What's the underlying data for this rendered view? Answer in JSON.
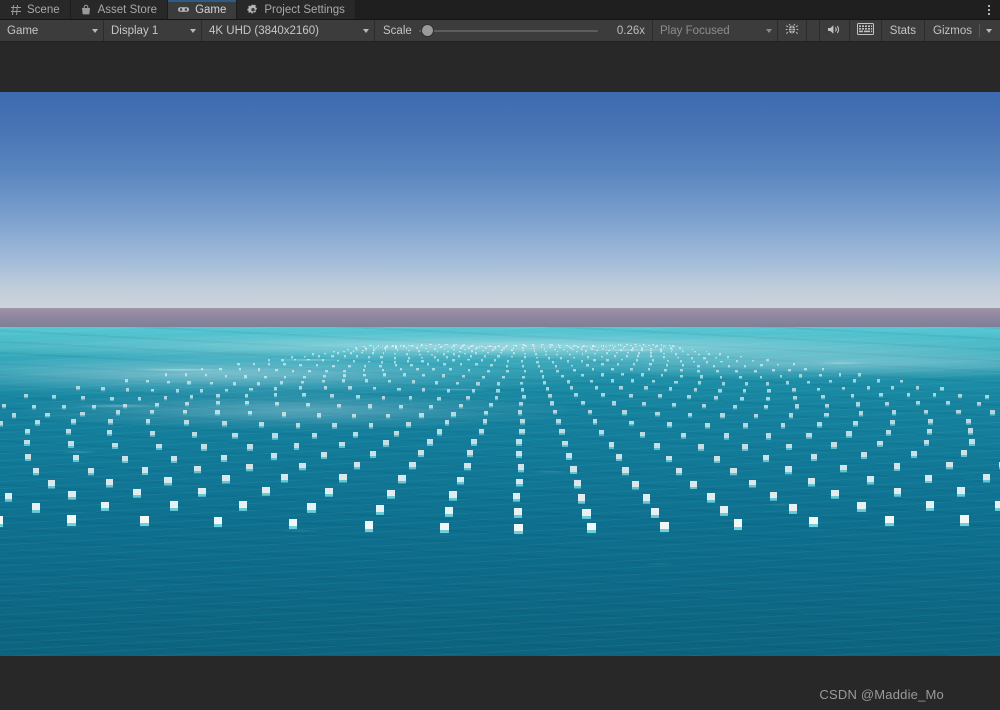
{
  "window": {
    "tabs": [
      {
        "label": "Scene",
        "icon": "grid-icon",
        "active": false
      },
      {
        "label": "Asset Store",
        "icon": "store-bag-icon",
        "active": false
      },
      {
        "label": "Game",
        "icon": "gamepad-icon",
        "active": true
      },
      {
        "label": "Project Settings",
        "icon": "gear-icon",
        "active": false
      }
    ],
    "overflow_menu_label": "⋮"
  },
  "toolbar": {
    "view_mode": "Game",
    "display": "Display 1",
    "resolution": "4K UHD (3840x2160)",
    "scale_label": "Scale",
    "scale_value": "0.26x",
    "scale_fraction": 0.02,
    "play_mode": "Play Focused",
    "debug_icon": "bug-icon",
    "mute_audio_icon": "speaker-icon",
    "stats_grid_icon": "frame-debug-grid-icon",
    "stats_label": "Stats",
    "gizmos_label": "Gizmos"
  },
  "game_view": {
    "scene_description": "Ocean surface with a large perspective grid of small white floating cube buoys under a clear blue sky",
    "sky_top_color": "#3d6bb0",
    "sky_horizon_color": "#cdd2dc",
    "haze_color": "#8d85a0",
    "water_near_color": "#0c647f",
    "water_far_color": "#3eb3c0",
    "buoy_color": "#f2f6f7",
    "buoy_rows": 26,
    "buoy_cols": 36,
    "watermark": "CSDN @Maddie_Mo"
  },
  "colors": {
    "tab_active_bg": "#3b3b3b",
    "tab_accent": "#2c5d87",
    "toolbar_bg": "#3c3c3c",
    "panel_bg": "#282828"
  }
}
